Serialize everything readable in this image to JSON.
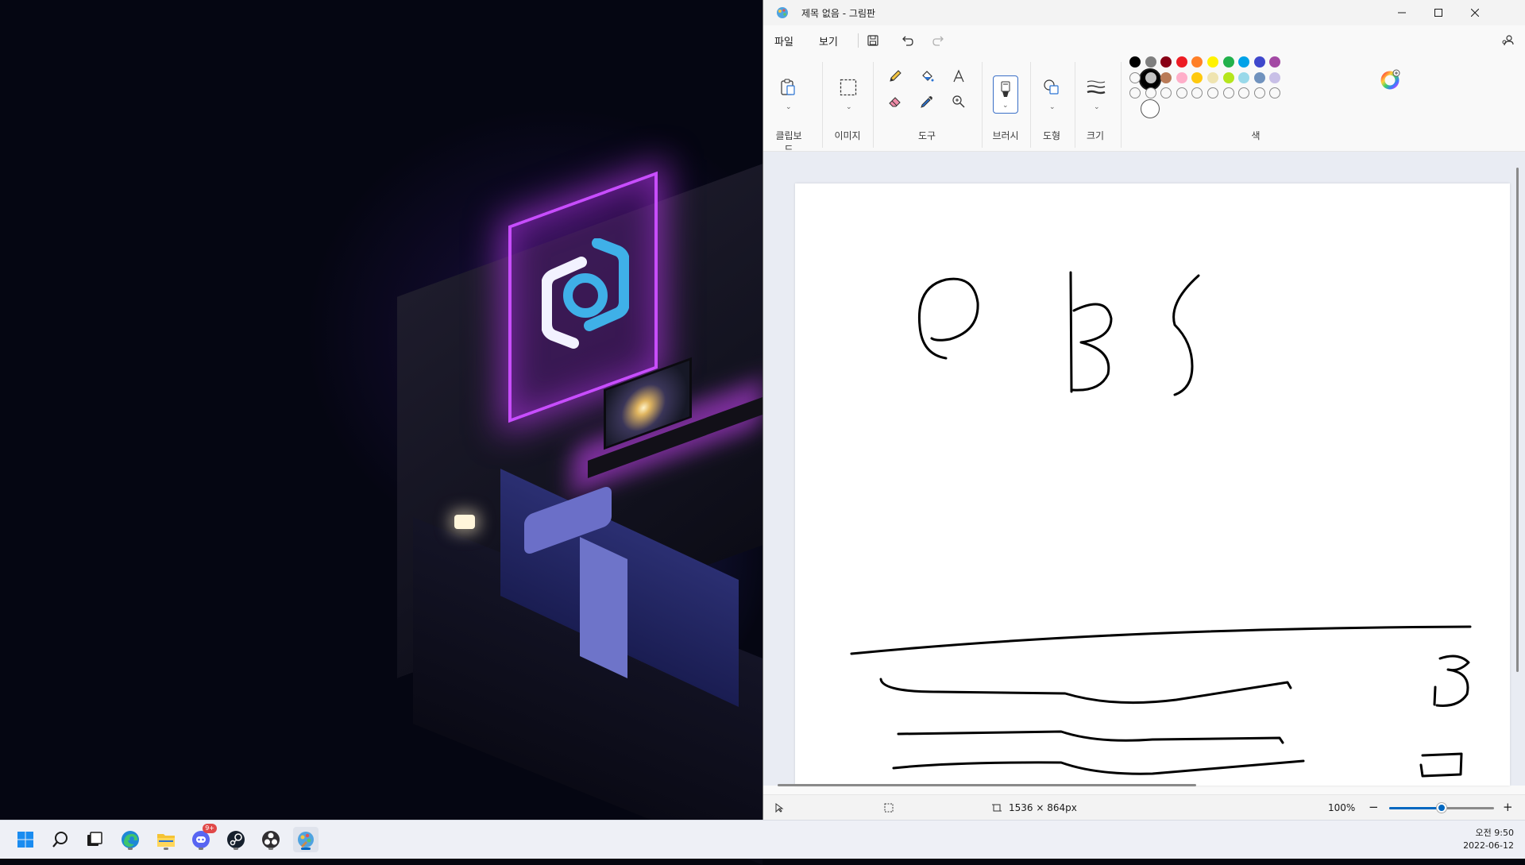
{
  "window": {
    "title": "제목 없음 - 그림판",
    "minimize_icon": "minimize-icon",
    "maximize_icon": "maximize-icon",
    "close_icon": "close-icon"
  },
  "menu": {
    "file": "파일",
    "view": "보기",
    "save_icon": "save-icon",
    "undo_icon": "undo-icon",
    "redo_icon": "redo-icon",
    "account_icon": "account-settings-icon"
  },
  "ribbon": {
    "groups": {
      "clipboard": "클립보드",
      "image": "이미지",
      "tools": "도구",
      "brushes": "브러시",
      "shapes": "도형",
      "size": "크기",
      "colors": "색"
    },
    "tools": [
      "pencil",
      "fill",
      "text",
      "eraser",
      "color-picker",
      "magnifier"
    ],
    "palette_row1": [
      "#000000",
      "#7f7f7f",
      "#880015",
      "#ed1c24",
      "#ff7f27",
      "#fff200",
      "#22b14c",
      "#00a2e8",
      "#3f48cc",
      "#a349a4"
    ],
    "palette_row2": [
      "empty",
      "#c3c3c3",
      "#b97a57",
      "#ffaec9",
      "#ffc90e",
      "#efe4b0",
      "#b5e61d",
      "#99d9ea",
      "#7092be",
      "#c8bfe7"
    ],
    "palette_row3": [
      "empty",
      "empty",
      "empty",
      "empty",
      "empty",
      "empty",
      "empty",
      "empty",
      "empty",
      "empty"
    ],
    "color1": "#000000",
    "color2": "#ffffff"
  },
  "status": {
    "canvas_size": "1536 × 864px",
    "zoom": "100%",
    "zoom_level": 0.5,
    "minus": "−",
    "plus": "+"
  },
  "taskbar": {
    "apps": [
      "windows-start",
      "search",
      "task-view",
      "edge",
      "file-explorer",
      "discord",
      "steam",
      "obs-studio",
      "paint"
    ],
    "discord_badge": "9+",
    "time": "오전 9:50",
    "date": "2022-06-12"
  }
}
